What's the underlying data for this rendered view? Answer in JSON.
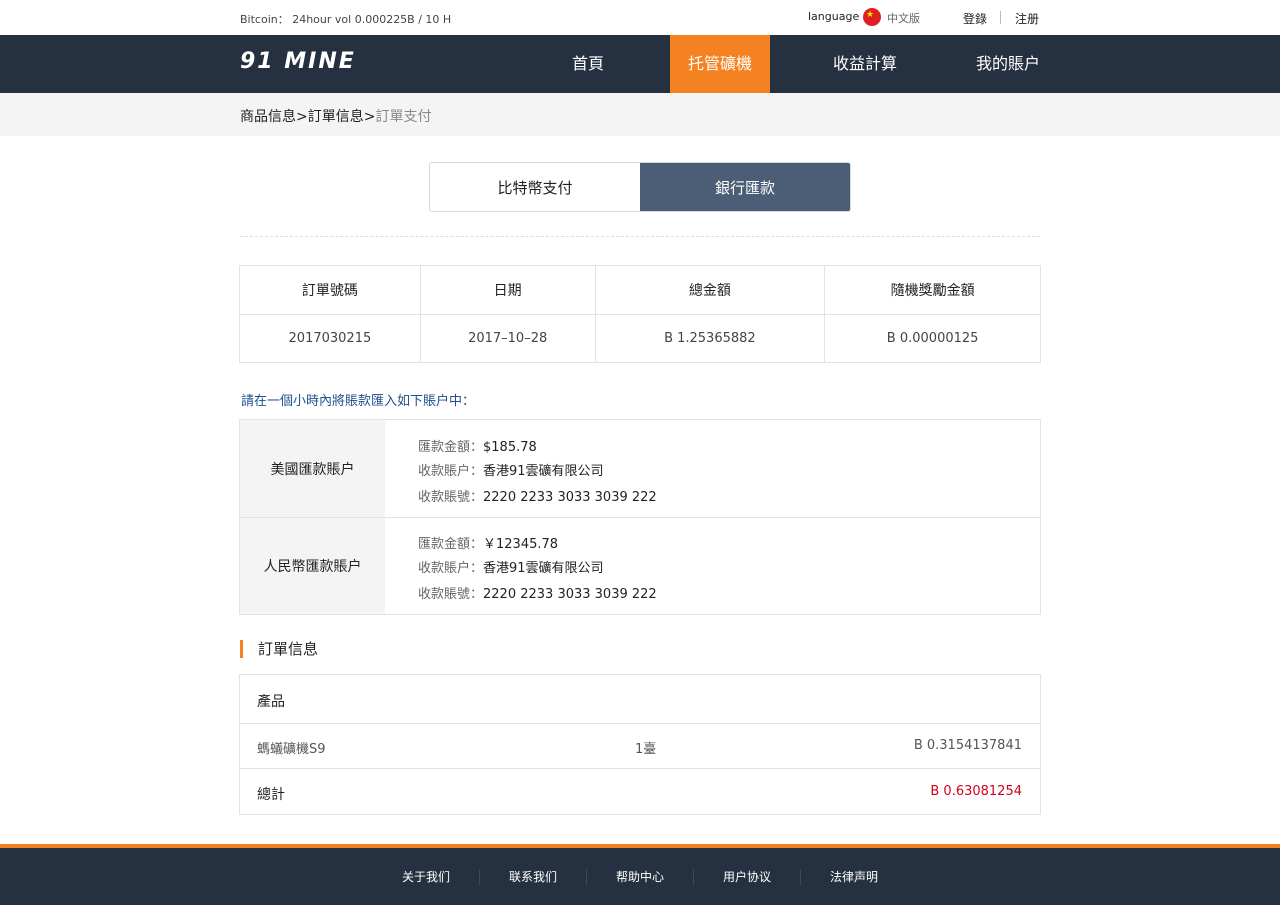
{
  "topbar": {
    "ticker": "Bitcoin： 24hour vol 0.000225B / 10 H",
    "language_label": "language",
    "language_value": "中文版",
    "login": "登錄",
    "register": "注册"
  },
  "nav": {
    "logo": "91 MINE",
    "items": [
      {
        "label": "首頁",
        "active": false
      },
      {
        "label": "托管礦機",
        "active": true
      },
      {
        "label": "收益計算",
        "active": false
      },
      {
        "label": "我的賬户",
        "active": false
      }
    ]
  },
  "breadcrumb": {
    "items": [
      "商品信息",
      "訂單信息",
      "訂單支付"
    ],
    "separator": ">"
  },
  "payment_tabs": [
    {
      "label": "比特幣支付",
      "active": false
    },
    {
      "label": "銀行匯款",
      "active": true
    }
  ],
  "order_table": {
    "headers": [
      "訂單號碼",
      "日期",
      "總金額",
      "隨機獎勵金額"
    ],
    "row": [
      "2017030215",
      "2017–10–28",
      "B 1.25365882",
      "B 0.00000125"
    ]
  },
  "notice": "請在一個小時內將賬款匯入如下賬户中：",
  "accounts": [
    {
      "label": "美國匯款賬户",
      "amount_key": "匯款金額：",
      "amount": "$185.78",
      "payee_key": "收款賬户：",
      "payee": "香港91雲礦有限公司",
      "number_key": "收款賬號：",
      "number": "2220 2233 3033 3039 222"
    },
    {
      "label": "人民幣匯款賬户",
      "amount_key": "匯款金額：",
      "amount": "￥12345.78",
      "payee_key": "收款賬户：",
      "payee": "香港91雲礦有限公司",
      "number_key": "收款賬號：",
      "number": "2220 2233 3033 3039 222"
    }
  ],
  "order_info": {
    "title": "訂單信息",
    "header": "產品",
    "product": {
      "name": "螞蟻礦機S9",
      "qty": "1臺",
      "price": "B 0.3154137841"
    },
    "total_label": "總計",
    "total_value": "B 0.63081254"
  },
  "footer": {
    "links": [
      "关于我们",
      "联系我们",
      "帮助中心",
      "用户协议",
      "法律声明"
    ]
  },
  "colors": {
    "nav_bg": "#253140",
    "accent": "#f58220",
    "tab_active": "#4b5e76",
    "total_red": "#d0021b",
    "notice_blue": "#1f4f8c"
  }
}
